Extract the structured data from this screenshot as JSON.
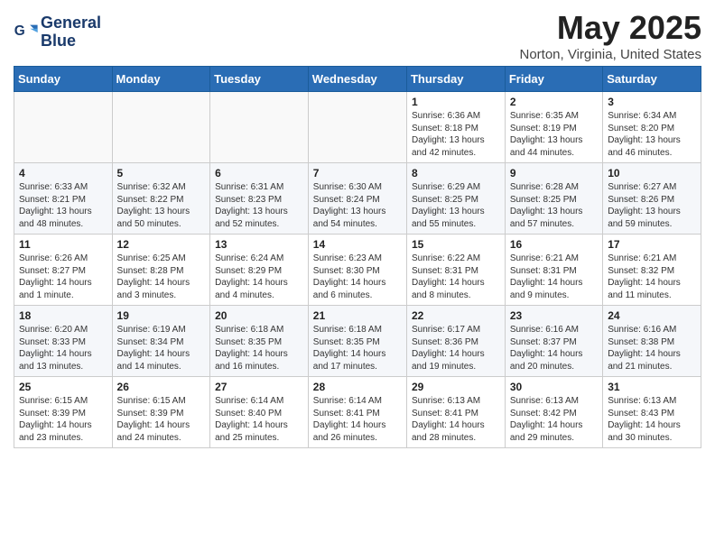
{
  "header": {
    "logo_line1": "General",
    "logo_line2": "Blue",
    "month": "May 2025",
    "location": "Norton, Virginia, United States"
  },
  "weekdays": [
    "Sunday",
    "Monday",
    "Tuesday",
    "Wednesday",
    "Thursday",
    "Friday",
    "Saturday"
  ],
  "weeks": [
    [
      {
        "day": "",
        "detail": ""
      },
      {
        "day": "",
        "detail": ""
      },
      {
        "day": "",
        "detail": ""
      },
      {
        "day": "",
        "detail": ""
      },
      {
        "day": "1",
        "detail": "Sunrise: 6:36 AM\nSunset: 8:18 PM\nDaylight: 13 hours and 42 minutes."
      },
      {
        "day": "2",
        "detail": "Sunrise: 6:35 AM\nSunset: 8:19 PM\nDaylight: 13 hours and 44 minutes."
      },
      {
        "day": "3",
        "detail": "Sunrise: 6:34 AM\nSunset: 8:20 PM\nDaylight: 13 hours and 46 minutes."
      }
    ],
    [
      {
        "day": "4",
        "detail": "Sunrise: 6:33 AM\nSunset: 8:21 PM\nDaylight: 13 hours and 48 minutes."
      },
      {
        "day": "5",
        "detail": "Sunrise: 6:32 AM\nSunset: 8:22 PM\nDaylight: 13 hours and 50 minutes."
      },
      {
        "day": "6",
        "detail": "Sunrise: 6:31 AM\nSunset: 8:23 PM\nDaylight: 13 hours and 52 minutes."
      },
      {
        "day": "7",
        "detail": "Sunrise: 6:30 AM\nSunset: 8:24 PM\nDaylight: 13 hours and 54 minutes."
      },
      {
        "day": "8",
        "detail": "Sunrise: 6:29 AM\nSunset: 8:25 PM\nDaylight: 13 hours and 55 minutes."
      },
      {
        "day": "9",
        "detail": "Sunrise: 6:28 AM\nSunset: 8:25 PM\nDaylight: 13 hours and 57 minutes."
      },
      {
        "day": "10",
        "detail": "Sunrise: 6:27 AM\nSunset: 8:26 PM\nDaylight: 13 hours and 59 minutes."
      }
    ],
    [
      {
        "day": "11",
        "detail": "Sunrise: 6:26 AM\nSunset: 8:27 PM\nDaylight: 14 hours and 1 minute."
      },
      {
        "day": "12",
        "detail": "Sunrise: 6:25 AM\nSunset: 8:28 PM\nDaylight: 14 hours and 3 minutes."
      },
      {
        "day": "13",
        "detail": "Sunrise: 6:24 AM\nSunset: 8:29 PM\nDaylight: 14 hours and 4 minutes."
      },
      {
        "day": "14",
        "detail": "Sunrise: 6:23 AM\nSunset: 8:30 PM\nDaylight: 14 hours and 6 minutes."
      },
      {
        "day": "15",
        "detail": "Sunrise: 6:22 AM\nSunset: 8:31 PM\nDaylight: 14 hours and 8 minutes."
      },
      {
        "day": "16",
        "detail": "Sunrise: 6:21 AM\nSunset: 8:31 PM\nDaylight: 14 hours and 9 minutes."
      },
      {
        "day": "17",
        "detail": "Sunrise: 6:21 AM\nSunset: 8:32 PM\nDaylight: 14 hours and 11 minutes."
      }
    ],
    [
      {
        "day": "18",
        "detail": "Sunrise: 6:20 AM\nSunset: 8:33 PM\nDaylight: 14 hours and 13 minutes."
      },
      {
        "day": "19",
        "detail": "Sunrise: 6:19 AM\nSunset: 8:34 PM\nDaylight: 14 hours and 14 minutes."
      },
      {
        "day": "20",
        "detail": "Sunrise: 6:18 AM\nSunset: 8:35 PM\nDaylight: 14 hours and 16 minutes."
      },
      {
        "day": "21",
        "detail": "Sunrise: 6:18 AM\nSunset: 8:35 PM\nDaylight: 14 hours and 17 minutes."
      },
      {
        "day": "22",
        "detail": "Sunrise: 6:17 AM\nSunset: 8:36 PM\nDaylight: 14 hours and 19 minutes."
      },
      {
        "day": "23",
        "detail": "Sunrise: 6:16 AM\nSunset: 8:37 PM\nDaylight: 14 hours and 20 minutes."
      },
      {
        "day": "24",
        "detail": "Sunrise: 6:16 AM\nSunset: 8:38 PM\nDaylight: 14 hours and 21 minutes."
      }
    ],
    [
      {
        "day": "25",
        "detail": "Sunrise: 6:15 AM\nSunset: 8:39 PM\nDaylight: 14 hours and 23 minutes."
      },
      {
        "day": "26",
        "detail": "Sunrise: 6:15 AM\nSunset: 8:39 PM\nDaylight: 14 hours and 24 minutes."
      },
      {
        "day": "27",
        "detail": "Sunrise: 6:14 AM\nSunset: 8:40 PM\nDaylight: 14 hours and 25 minutes."
      },
      {
        "day": "28",
        "detail": "Sunrise: 6:14 AM\nSunset: 8:41 PM\nDaylight: 14 hours and 26 minutes."
      },
      {
        "day": "29",
        "detail": "Sunrise: 6:13 AM\nSunset: 8:41 PM\nDaylight: 14 hours and 28 minutes."
      },
      {
        "day": "30",
        "detail": "Sunrise: 6:13 AM\nSunset: 8:42 PM\nDaylight: 14 hours and 29 minutes."
      },
      {
        "day": "31",
        "detail": "Sunrise: 6:13 AM\nSunset: 8:43 PM\nDaylight: 14 hours and 30 minutes."
      }
    ]
  ]
}
